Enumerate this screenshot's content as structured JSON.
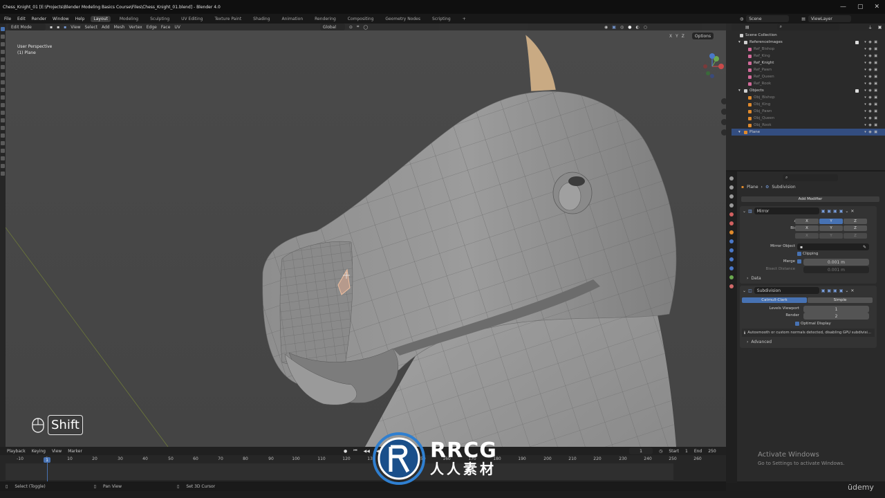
{
  "window": {
    "title": "Chess_Knight_01 [E:\\Projects\\Blender Modeling Basics Course\\Files\\Chess_Knight_01.blend] - Blender 4.0",
    "controls": [
      "—",
      "▢",
      "✕"
    ]
  },
  "topbar": {
    "menus": [
      "File",
      "Edit",
      "Render",
      "Window",
      "Help"
    ],
    "workspaces": [
      "Layout",
      "Modeling",
      "Sculpting",
      "UV Editing",
      "Texture Paint",
      "Shading",
      "Animation",
      "Rendering",
      "Compositing",
      "Geometry Nodes",
      "Scripting",
      "+"
    ],
    "active_workspace": "Layout",
    "scene": "Scene",
    "view_layer": "ViewLayer"
  },
  "viewport": {
    "mode": "Edit Mode",
    "menus": [
      "View",
      "Select",
      "Add",
      "Mesh",
      "Vertex",
      "Edge",
      "Face",
      "UV"
    ],
    "orientation": "Global",
    "options_label": "Options",
    "axes": [
      "X",
      "Y",
      "Z"
    ],
    "info_line1": "User Perspective",
    "info_line2": "(1) Plane",
    "shift_label": "Shift"
  },
  "outliner": {
    "search_placeholder": "",
    "rows": [
      {
        "label": "Scene Collection",
        "indent": 0,
        "icon": "collection-icon",
        "dim": false,
        "checkbox": false,
        "vis": false,
        "icon_color": "#cfcfcf"
      },
      {
        "label": "ReferenceImages",
        "indent": 1,
        "icon": "collection-icon",
        "dim": false,
        "checkbox": true,
        "vis": true,
        "icon_color": "#cfcfcf"
      },
      {
        "label": "Ref_Bishop",
        "indent": 2,
        "icon": "image-empty-icon",
        "dim": true,
        "checkbox": false,
        "vis": true,
        "icon_color": "#d26a9a"
      },
      {
        "label": "Ref_King",
        "indent": 2,
        "icon": "image-empty-icon",
        "dim": true,
        "checkbox": false,
        "vis": true,
        "icon_color": "#d26a9a"
      },
      {
        "label": "Ref_Knight",
        "indent": 2,
        "icon": "image-empty-icon",
        "dim": false,
        "checkbox": false,
        "vis": true,
        "icon_color": "#d26a9a"
      },
      {
        "label": "Ref_Pawn",
        "indent": 2,
        "icon": "image-empty-icon",
        "dim": true,
        "checkbox": false,
        "vis": true,
        "icon_color": "#d26a9a"
      },
      {
        "label": "Ref_Queen",
        "indent": 2,
        "icon": "image-empty-icon",
        "dim": true,
        "checkbox": false,
        "vis": true,
        "icon_color": "#d26a9a"
      },
      {
        "label": "Ref_Rook",
        "indent": 2,
        "icon": "image-empty-icon",
        "dim": true,
        "checkbox": false,
        "vis": true,
        "icon_color": "#d26a9a"
      },
      {
        "label": "Objects",
        "indent": 1,
        "icon": "collection-icon",
        "dim": false,
        "checkbox": true,
        "vis": true,
        "icon_color": "#cfcfcf"
      },
      {
        "label": "Obj_Bishop",
        "indent": 2,
        "icon": "mesh-icon",
        "dim": true,
        "checkbox": false,
        "vis": true,
        "icon_color": "#e08a2c"
      },
      {
        "label": "Obj_King",
        "indent": 2,
        "icon": "mesh-icon",
        "dim": true,
        "checkbox": false,
        "vis": true,
        "icon_color": "#e08a2c"
      },
      {
        "label": "Obj_Pawn",
        "indent": 2,
        "icon": "mesh-icon",
        "dim": true,
        "checkbox": false,
        "vis": true,
        "icon_color": "#e08a2c"
      },
      {
        "label": "Obj_Queen",
        "indent": 2,
        "icon": "mesh-icon",
        "dim": true,
        "checkbox": false,
        "vis": true,
        "icon_color": "#e08a2c"
      },
      {
        "label": "Obj_Rook",
        "indent": 2,
        "icon": "mesh-icon",
        "dim": true,
        "checkbox": false,
        "vis": true,
        "icon_color": "#e08a2c"
      },
      {
        "label": "Plane",
        "indent": 1,
        "icon": "mesh-icon",
        "dim": false,
        "checkbox": false,
        "vis": true,
        "icon_color": "#e08a2c",
        "selected": true
      }
    ]
  },
  "properties": {
    "breadcrumb_object": "Plane",
    "breadcrumb_modifier": "Subdivision",
    "add_modifier": "Add Modifier",
    "mirror": {
      "name": "Mirror",
      "axis_label": "Axis",
      "bisect_label": "Bisect",
      "flip_label": "Flip",
      "axes": [
        "X",
        "Y",
        "Z"
      ],
      "axis_active": "Y",
      "mirror_object_label": "Mirror Object",
      "clipping_label": "Clipping",
      "merge_label": "Merge",
      "merge_value": "0.001 m",
      "bisect_distance_label": "Bisect Distance",
      "bisect_distance_value": "0.001 m",
      "data_label": "Data"
    },
    "subdivision": {
      "name": "Subdivision",
      "method_active": "Catmull-Clark",
      "method_other": "Simple",
      "levels_viewport_label": "Levels Viewport",
      "levels_viewport_value": "1",
      "render_label": "Render",
      "render_value": "2",
      "optimal_display_label": "Optimal Display",
      "warning": "Autosmooth or custom normals detected, disabling GPU subdivisi...",
      "advanced_label": "Advanced"
    }
  },
  "timeline": {
    "menus": [
      "Playback",
      "Keying",
      "View",
      "Marker"
    ],
    "current_frame": "1",
    "start_label": "Start",
    "start_value": "1",
    "end_label": "End",
    "end_value": "250",
    "ruler": [
      "-10",
      "1",
      "10",
      "20",
      "30",
      "40",
      "50",
      "60",
      "70",
      "80",
      "90",
      "100",
      "110",
      "120",
      "130",
      "140",
      "150",
      "160",
      "170",
      "180",
      "190",
      "200",
      "210",
      "220",
      "230",
      "240",
      "250",
      "260"
    ]
  },
  "statusbar": {
    "items": [
      "Select (Toggle)",
      "Pan View",
      "Set 3D Cursor"
    ]
  },
  "overlay": {
    "activate_title": "Activate Windows",
    "activate_sub": "Go to Settings to activate Windows.",
    "udemy": "ūdemy",
    "watermark_top": "RRCG",
    "watermark_bottom": "人人素材"
  }
}
